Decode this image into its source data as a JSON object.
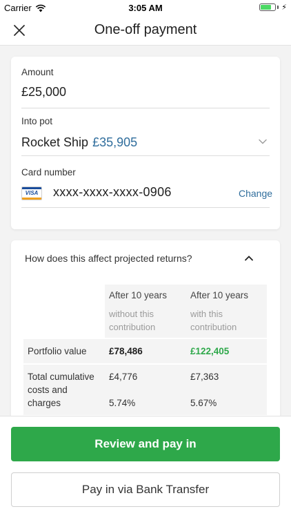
{
  "status_bar": {
    "carrier": "Carrier",
    "time": "3:05 AM",
    "icons": [
      "wifi-icon",
      "battery-icon",
      "charging-bolt-icon"
    ]
  },
  "nav": {
    "title": "One-off payment",
    "close_icon": "close-icon"
  },
  "payment": {
    "amount_label": "Amount",
    "amount_value": "£25,000",
    "pot_label": "Into pot",
    "pot_name": "Rocket Ship",
    "pot_balance": "£35,905",
    "card_label": "Card number",
    "card_brand": "VISA",
    "card_number": "xxxx-xxxx-xxxx-0906",
    "change_label": "Change"
  },
  "returns": {
    "question": "How does this affect projected returns?",
    "columns": [
      {
        "title": "After 10 years",
        "subtitle": "without this contribution"
      },
      {
        "title": "After 10 years",
        "subtitle": "with this contribution"
      }
    ],
    "rows": [
      {
        "label": "Portfolio value",
        "without": "£78,486",
        "with": "£122,405"
      },
      {
        "label": "Total cumulative costs and charges",
        "without": "£4,776",
        "with": "£7,363",
        "without_pct": "5.74%",
        "with_pct": "5.67%"
      }
    ]
  },
  "actions": {
    "primary": "Review and pay in",
    "secondary": "Pay in via Bank Transfer"
  },
  "colors": {
    "accent_green": "#2ea84a",
    "link_blue": "#2f6d9c",
    "background": "#f3f3f3"
  }
}
